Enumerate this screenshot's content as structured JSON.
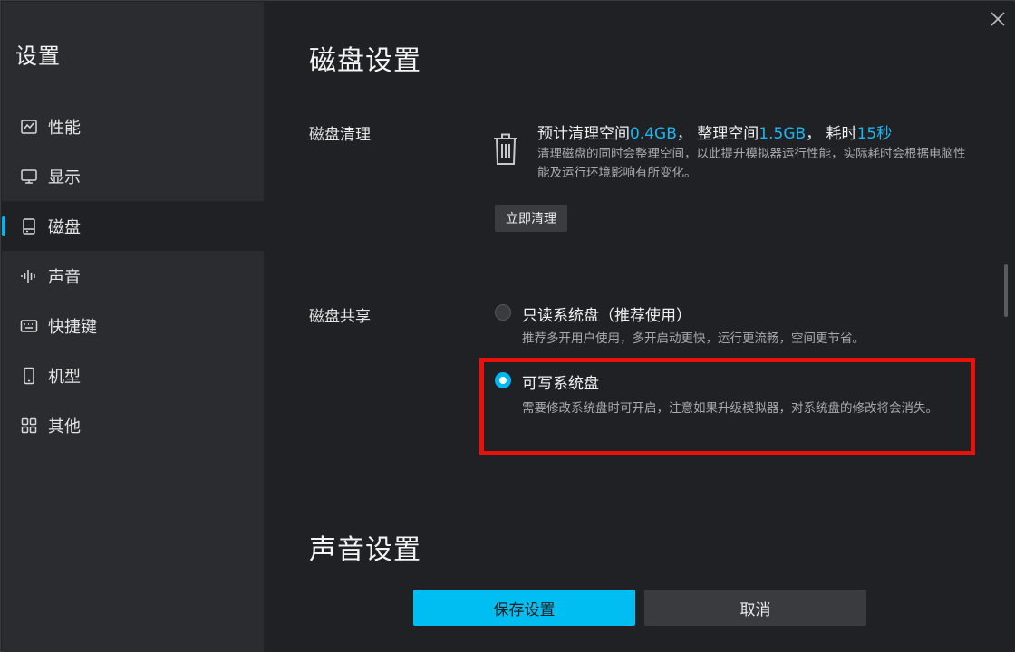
{
  "sidebar": {
    "title": "设置",
    "items": [
      {
        "label": "性能",
        "icon": "performance-chart-icon",
        "active": false
      },
      {
        "label": "显示",
        "icon": "monitor-icon",
        "active": false
      },
      {
        "label": "磁盘",
        "icon": "disk-icon",
        "active": true
      },
      {
        "label": "声音",
        "icon": "sound-wave-icon",
        "active": false
      },
      {
        "label": "快捷键",
        "icon": "keyboard-icon",
        "active": false
      },
      {
        "label": "机型",
        "icon": "phone-icon",
        "active": false
      },
      {
        "label": "其他",
        "icon": "grid-icon",
        "active": false
      }
    ]
  },
  "disk_section": {
    "title": "磁盘设置",
    "cleanup": {
      "label": "磁盘清理",
      "summary_prefix": "预计清理空间",
      "clean_space": "0.4GB",
      "sep1": "， 整理空间",
      "organize_space": "1.5GB",
      "sep2": "， 耗时",
      "time": "15秒",
      "description": "清理磁盘的同时会整理空间，以此提升模拟器运行性能，实际耗时会根据电脑性能及运行环境影响有所变化。",
      "button_label": "立即清理"
    },
    "sharing": {
      "label": "磁盘共享",
      "options": [
        {
          "title": "只读系统盘（推荐使用）",
          "description": "推荐多开用户使用，多开启动更快，运行更流畅，空间更节省。",
          "selected": false
        },
        {
          "title": "可写系统盘",
          "description": "需要修改系统盘时可开启，注意如果升级模拟器，对系统盘的修改将会消失。",
          "selected": true
        }
      ]
    }
  },
  "sound_section": {
    "title": "声音设置"
  },
  "footer": {
    "save_label": "保存设置",
    "cancel_label": "取消"
  },
  "colors": {
    "accent": "#00b7f0",
    "highlight_value": "#1fb5f0",
    "annotation_border": "#e8120c"
  }
}
